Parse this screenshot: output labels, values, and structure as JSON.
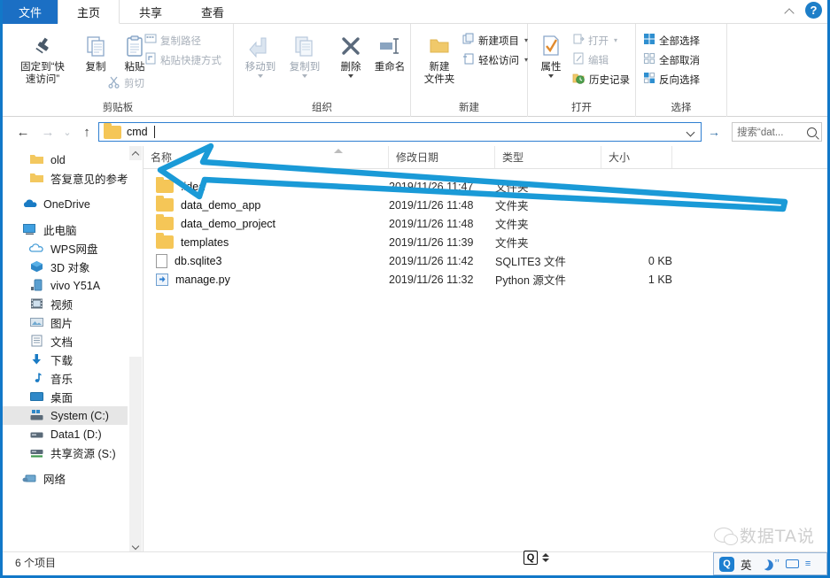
{
  "window": {
    "accent_color": "#1278c8",
    "tab_blue": "#1b6fc4",
    "annotation_color": "#1a9ad7"
  },
  "tabs": [
    {
      "label": "文件",
      "name": "tab-file"
    },
    {
      "label": "主页",
      "name": "tab-home"
    },
    {
      "label": "共享",
      "name": "tab-share"
    },
    {
      "label": "查看",
      "name": "tab-view"
    }
  ],
  "titlebar": {
    "collapse_icon": "chevron-up-icon",
    "help_icon": "help-icon",
    "help_glyph": "?"
  },
  "ribbon": {
    "groups": [
      {
        "name": "clipboard",
        "title": "剪贴板",
        "buttons": [
          {
            "label": "固定到“快\n速访问”",
            "line1": "固定到“快",
            "line2": "速访问”",
            "icon": "pin-icon"
          },
          {
            "label": "复制",
            "icon": "copy-icon"
          },
          {
            "label": "粘贴",
            "icon": "paste-icon"
          }
        ],
        "small_buttons": [
          {
            "label": "复制路径",
            "icon": "copy-path-icon"
          },
          {
            "label": "粘贴快捷方式",
            "icon": "paste-shortcut-icon"
          },
          {
            "label": "剪切",
            "icon": "scissors-icon"
          }
        ]
      },
      {
        "name": "organize",
        "title": "组织",
        "buttons": [
          {
            "label": "移动到",
            "icon": "move-to-icon",
            "disabled": true
          },
          {
            "label": "复制到",
            "icon": "copy-to-icon",
            "disabled": true
          },
          {
            "label": "删除",
            "icon": "delete-x-icon"
          },
          {
            "label": "重命名",
            "icon": "rename-icon"
          }
        ]
      },
      {
        "name": "new",
        "title": "新建",
        "buttons": [
          {
            "line1": "新建",
            "line2": "文件夹",
            "icon": "new-folder-icon"
          }
        ],
        "small_buttons": [
          {
            "label": "新建项目",
            "icon": "new-item-icon",
            "caret": true
          },
          {
            "label": "轻松访问",
            "icon": "easy-access-icon",
            "caret": true
          }
        ]
      },
      {
        "name": "open",
        "title": "打开",
        "buttons": [
          {
            "label": "属性",
            "icon": "properties-icon"
          }
        ],
        "small_buttons": [
          {
            "label": "打开",
            "icon": "open-icon",
            "caret": true,
            "disabled": true
          },
          {
            "label": "编辑",
            "icon": "edit-icon",
            "disabled": true
          },
          {
            "label": "历史记录",
            "icon": "history-icon"
          }
        ]
      },
      {
        "name": "select",
        "title": "选择",
        "small_buttons": [
          {
            "label": "全部选择",
            "icon": "select-all-icon"
          },
          {
            "label": "全部取消",
            "icon": "select-none-icon"
          },
          {
            "label": "反向选择",
            "icon": "invert-selection-icon"
          }
        ]
      }
    ]
  },
  "addressbar": {
    "back_icon": "back-arrow-icon",
    "forward_icon": "forward-arrow-icon",
    "recent_icon": "chevron-down-icon",
    "up_icon": "up-arrow-icon",
    "folder_icon": "folder-icon",
    "value": "cmd",
    "dropdown_icon": "chevron-down-icon",
    "go_icon": "go-arrow-icon",
    "go_glyph": "→",
    "back_glyph": "←",
    "forward_glyph": "→",
    "recent_glyph": "⌄",
    "up_glyph": "↑"
  },
  "search": {
    "placeholder": "搜索“dat...",
    "icon": "search-icon"
  },
  "sidebar": {
    "items": [
      {
        "label": "old",
        "icon": "folder-icon",
        "indent": 2,
        "selected": false
      },
      {
        "label": "答复意见的参考",
        "icon": "folder-icon",
        "indent": 2,
        "selected": false
      },
      {
        "gap": true
      },
      {
        "label": "OneDrive",
        "icon": "onedrive-cloud-icon",
        "indent": 1,
        "selected": false
      },
      {
        "gap": true
      },
      {
        "label": "此电脑",
        "icon": "this-pc-icon",
        "indent": 1,
        "selected": false
      },
      {
        "label": "WPS网盘",
        "icon": "wps-cloud-icon",
        "indent": 2,
        "selected": false
      },
      {
        "label": "3D 对象",
        "icon": "3d-objects-icon",
        "indent": 2,
        "selected": false
      },
      {
        "label": "vivo Y51A",
        "icon": "phone-icon",
        "indent": 2,
        "selected": false
      },
      {
        "label": "视频",
        "icon": "videos-icon",
        "indent": 2,
        "selected": false
      },
      {
        "label": "图片",
        "icon": "pictures-icon",
        "indent": 2,
        "selected": false
      },
      {
        "label": "文档",
        "icon": "documents-icon",
        "indent": 2,
        "selected": false
      },
      {
        "label": "下载",
        "icon": "downloads-icon",
        "indent": 2,
        "selected": false
      },
      {
        "label": "音乐",
        "icon": "music-icon",
        "indent": 2,
        "selected": false
      },
      {
        "label": "桌面",
        "icon": "desktop-icon",
        "indent": 2,
        "selected": false
      },
      {
        "label": "System (C:)",
        "icon": "system-drive-icon",
        "indent": 2,
        "selected": true
      },
      {
        "label": "Data1 (D:)",
        "icon": "drive-icon",
        "indent": 2,
        "selected": false
      },
      {
        "label": "共享资源 (S:)",
        "icon": "network-drive-icon",
        "indent": 2,
        "selected": false
      },
      {
        "gap": true
      },
      {
        "label": "网络",
        "icon": "network-icon",
        "indent": 1,
        "selected": false
      }
    ],
    "scroll_up_icon": "chevron-up-icon",
    "scroll_down_icon": "chevron-down-icon"
  },
  "filelist": {
    "columns": [
      {
        "label": "名称",
        "name": "column-name"
      },
      {
        "label": "修改日期",
        "name": "column-date-modified"
      },
      {
        "label": "类型",
        "name": "column-type"
      },
      {
        "label": "大小",
        "name": "column-size"
      }
    ],
    "rows": [
      {
        "name": ".idea",
        "date": "2019/11/26 11:47",
        "type": "文件夹",
        "size": "",
        "icon": "folder-icon"
      },
      {
        "name": "data_demo_app",
        "date": "2019/11/26 11:48",
        "type": "文件夹",
        "size": "",
        "icon": "folder-icon"
      },
      {
        "name": "data_demo_project",
        "date": "2019/11/26 11:48",
        "type": "文件夹",
        "size": "",
        "icon": "folder-icon"
      },
      {
        "name": "templates",
        "date": "2019/11/26 11:39",
        "type": "文件夹",
        "size": "",
        "icon": "folder-icon"
      },
      {
        "name": "db.sqlite3",
        "date": "2019/11/26 11:42",
        "type": "SQLITE3 文件",
        "size": "0 KB",
        "icon": "file-icon"
      },
      {
        "name": "manage.py",
        "date": "2019/11/26 11:32",
        "type": "Python 源文件",
        "size": "1 KB",
        "icon": "python-file-icon"
      }
    ]
  },
  "statusbar": {
    "item_count": "6 个项目"
  },
  "scroll_widget": {
    "glyph": "Q",
    "up_icon": "triangle-up-icon",
    "down_icon": "triangle-down-icon"
  },
  "watermark": {
    "text": "数据TA说",
    "icon": "wechat-icon"
  },
  "ime": {
    "logo_glyph": "Q",
    "mode": "英",
    "moon_icon": "moon-icon",
    "punct": "’’",
    "keyboard_icon": "keyboard-icon",
    "more_glyph": "≡"
  }
}
